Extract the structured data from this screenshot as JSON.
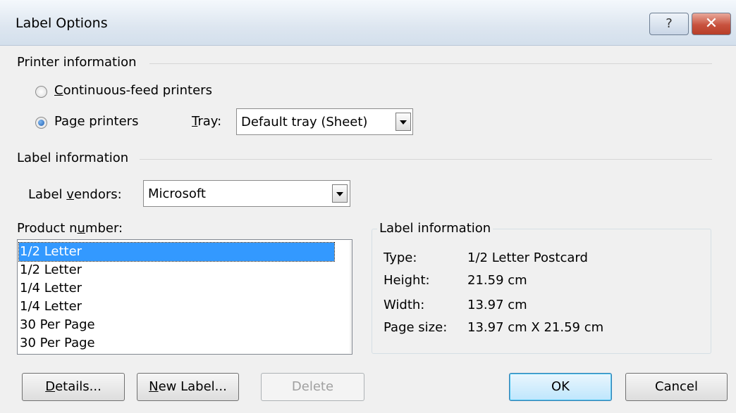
{
  "window": {
    "title": "Label Options",
    "help_glyph": "?",
    "close_glyph": "✕"
  },
  "printer": {
    "section_title": "Printer information",
    "continuous": {
      "pre": "",
      "ul": "C",
      "post": "ontinuous-feed printers"
    },
    "page": {
      "pre": "Pa",
      "ul": "g",
      "post": "e printers"
    },
    "tray_label": {
      "pre": "",
      "ul": "T",
      "post": "ray:"
    },
    "tray_value": "Default tray (Sheet)"
  },
  "label_info": {
    "section_title": "Label information",
    "vendors_label": {
      "pre": "Label ",
      "ul": "v",
      "post": "endors:"
    },
    "vendor_value": "Microsoft"
  },
  "product": {
    "label": {
      "pre": "Product n",
      "ul": "u",
      "post": "mber:"
    },
    "items": [
      "1/2 Letter",
      "1/2 Letter",
      "1/4 Letter",
      "1/4 Letter",
      "30 Per Page",
      "30 Per Page"
    ]
  },
  "details": {
    "title": "Label information",
    "rows": [
      {
        "key": "Type:",
        "value": "1/2 Letter Postcard"
      },
      {
        "key": "Height:",
        "value": "21.59 cm"
      },
      {
        "key": "Width:",
        "value": "13.97 cm"
      },
      {
        "key": "Page size:",
        "value": "13.97 cm X 21.59 cm"
      }
    ]
  },
  "buttons": {
    "details": {
      "pre": "",
      "ul": "D",
      "post": "etails..."
    },
    "new_label": {
      "pre": "",
      "ul": "N",
      "post": "ew Label..."
    },
    "delete": "Delete",
    "ok": "OK",
    "cancel": "Cancel"
  }
}
